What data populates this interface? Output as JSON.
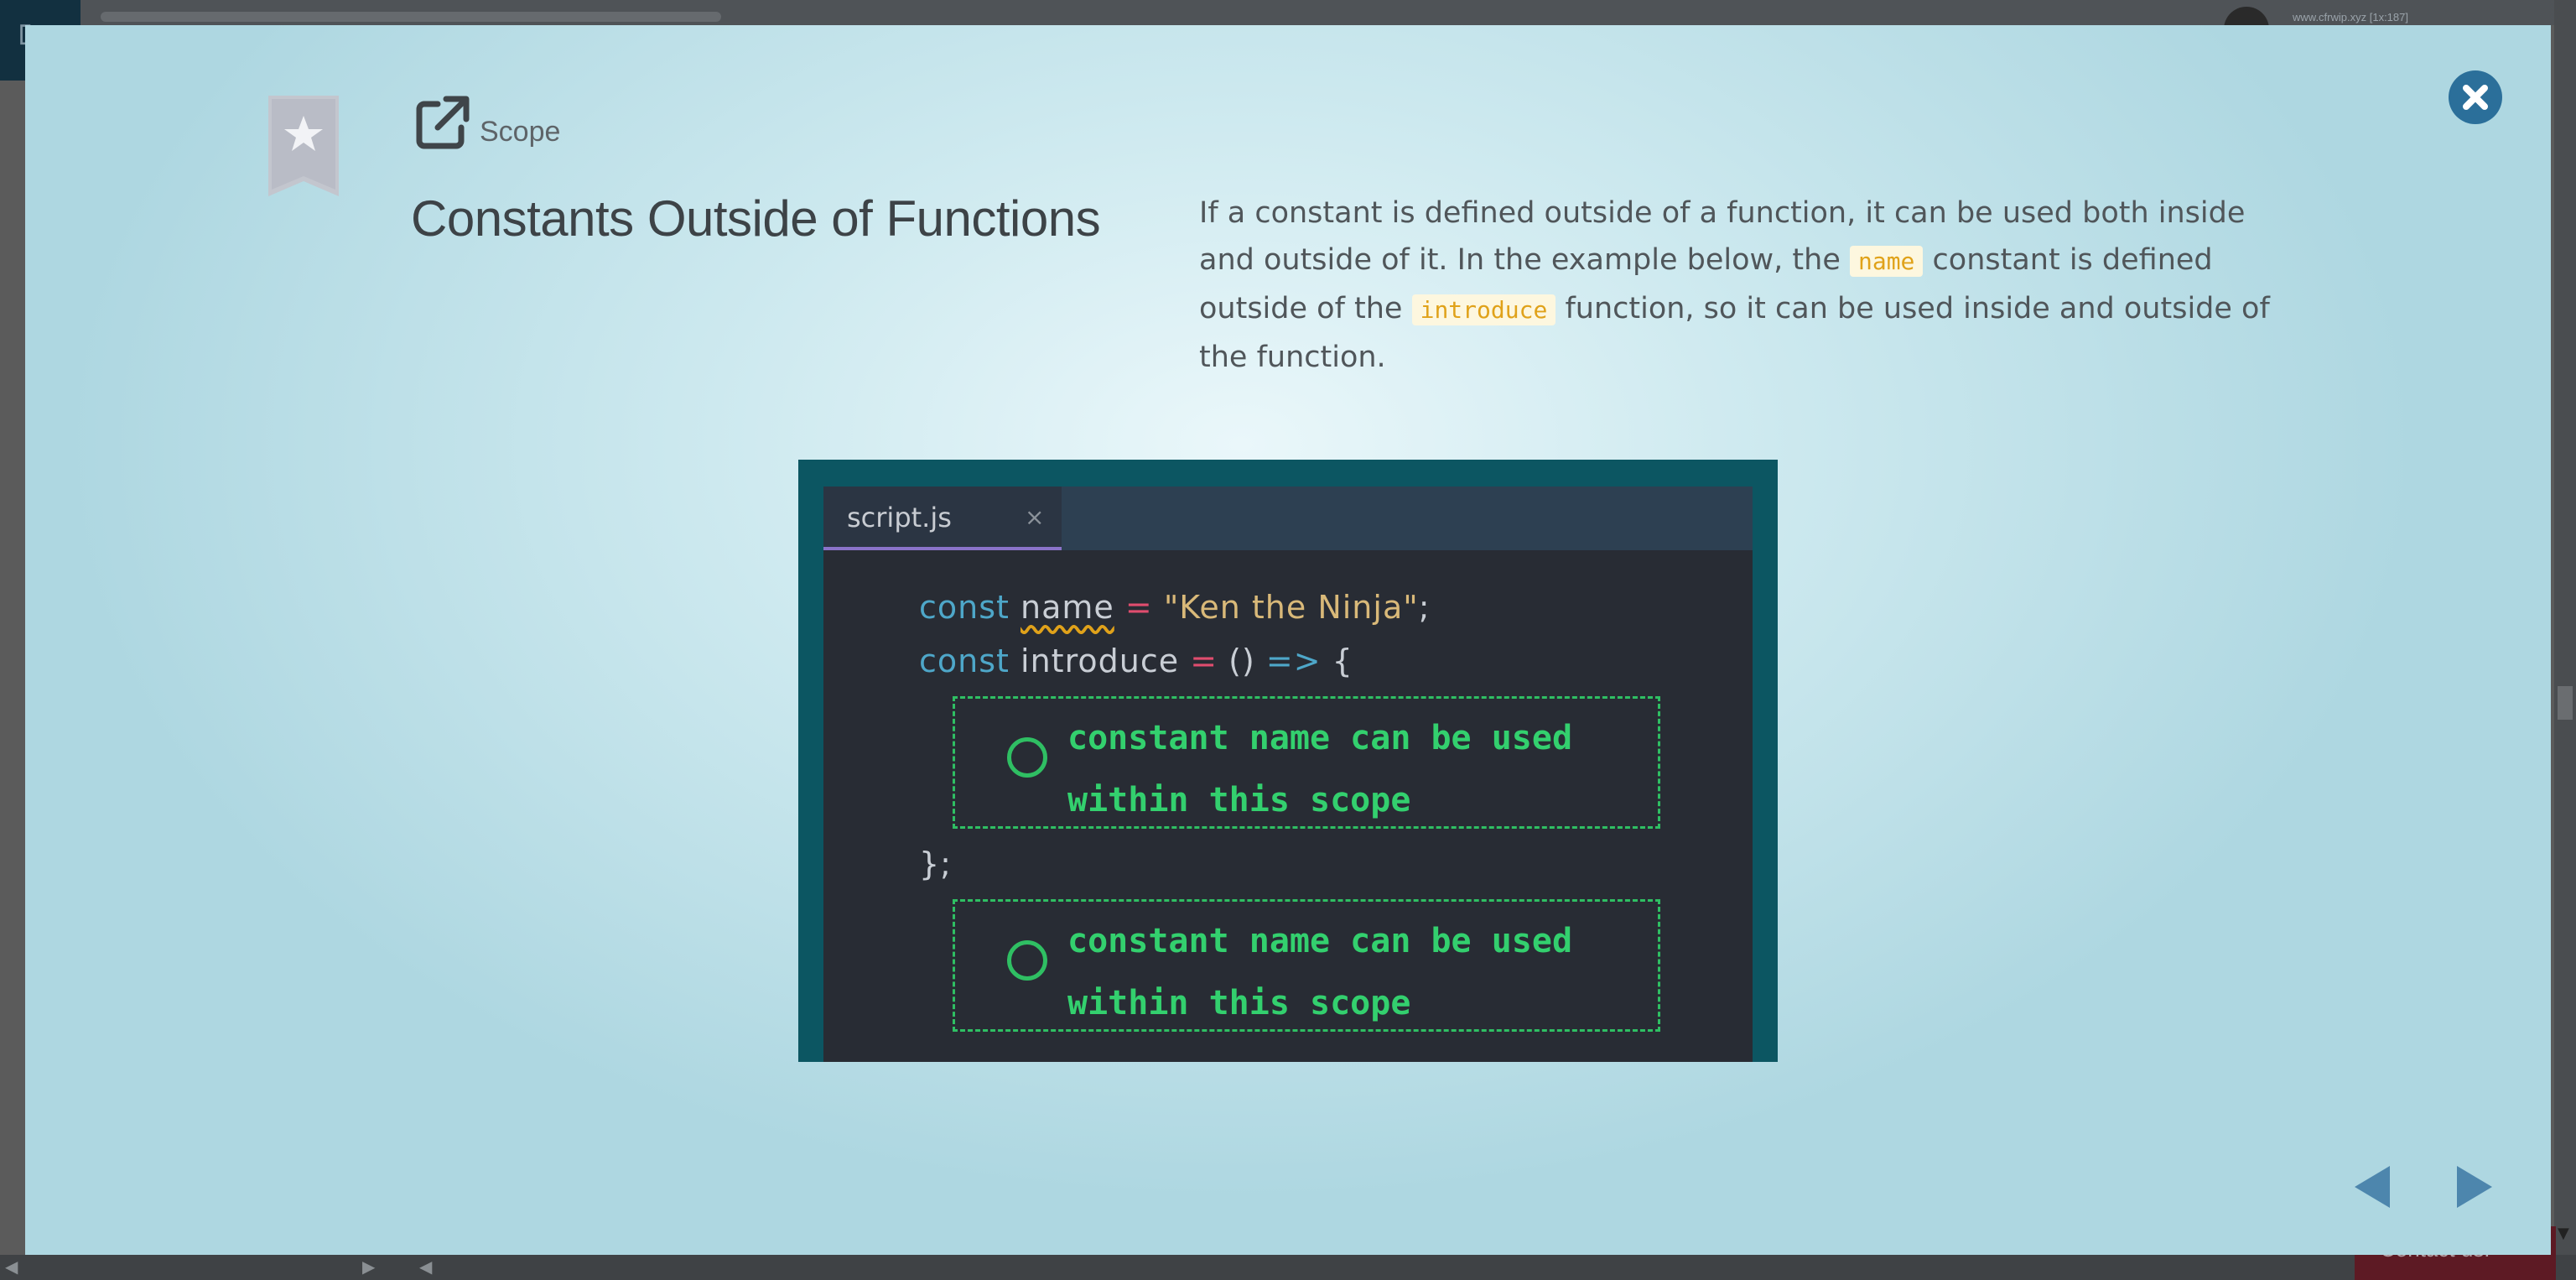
{
  "background": {
    "site_label": "www.cfrwip.xyz [1x:187]",
    "contact_label": "Contact us!",
    "scroll_left": "◀",
    "scroll_right": "▶"
  },
  "modal": {
    "lesson": "Scope",
    "title": "Constants Outside of Functions",
    "description": {
      "part1": "If a constant is defined outside of a function, it can be used both inside and outside of it. In the example below, the ",
      "code1": "name",
      "part2": " constant is defined outside of the ",
      "code2": "introduce",
      "part3": " function, so it can be used inside and outside of the function."
    },
    "code_image": {
      "tab_label": "script.js",
      "tab_close": "×",
      "line1": {
        "kw": "const",
        "name": "name",
        "op": "=",
        "str": "\"Ken the Ninja\"",
        "end": ";"
      },
      "line2": {
        "kw": "const",
        "name": "introduce",
        "op": "=",
        "parens": "()",
        "arrow": "=>",
        "brace": "{"
      },
      "line3": "};",
      "annotation1": "constant name can be used within this scope",
      "annotation2": "constant name can be used within this scope"
    }
  },
  "icons": {
    "bookmark": "bookmark-star-icon",
    "external": "external-link-icon",
    "close": "close-icon",
    "prev": "triangle-left-icon",
    "next": "triangle-right-icon"
  },
  "colors": {
    "close_button": "#2b6f9a",
    "nav_arrow": "#4d86ad",
    "code_highlight": "#e0a21a",
    "annotation_green": "#33d06e"
  }
}
